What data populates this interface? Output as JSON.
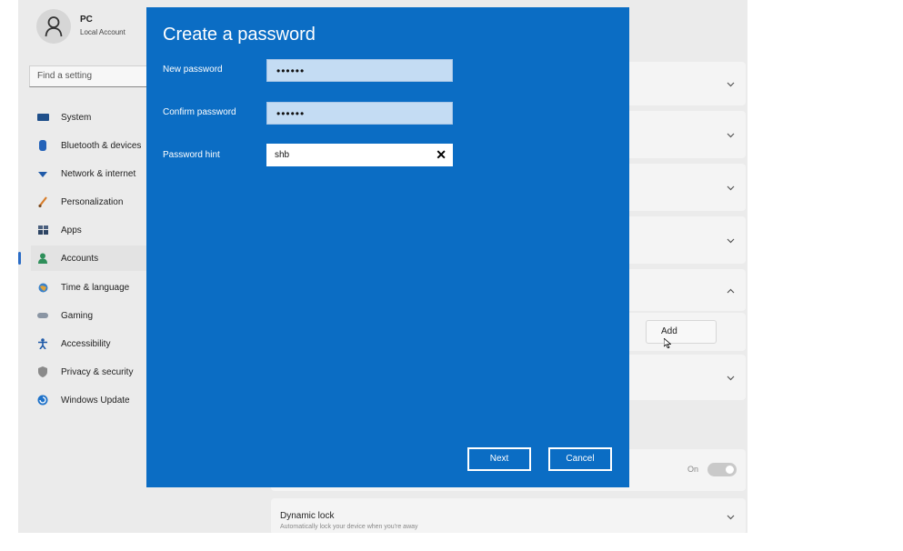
{
  "account": {
    "name": "PC",
    "type": "Local Account"
  },
  "search": {
    "placeholder": "Find a setting"
  },
  "sidebar": {
    "items": [
      {
        "label": "System",
        "icon": "monitor-icon"
      },
      {
        "label": "Bluetooth & devices",
        "icon": "bluetooth-icon"
      },
      {
        "label": "Network & internet",
        "icon": "wifi-icon"
      },
      {
        "label": "Personalization",
        "icon": "brush-icon"
      },
      {
        "label": "Apps",
        "icon": "apps-icon"
      },
      {
        "label": "Accounts",
        "icon": "person-icon",
        "active": true
      },
      {
        "label": "Time & language",
        "icon": "globe-icon"
      },
      {
        "label": "Gaming",
        "icon": "gamepad-icon"
      },
      {
        "label": "Accessibility",
        "icon": "accessibility-icon"
      },
      {
        "label": "Privacy & security",
        "icon": "shield-icon"
      },
      {
        "label": "Windows Update",
        "icon": "update-icon"
      }
    ]
  },
  "background": {
    "add_label": "Add",
    "toggle_label": "On",
    "dynamic_lock": {
      "title": "Dynamic lock",
      "subtitle": "Automatically lock your device when you're away"
    }
  },
  "dialog": {
    "title": "Create a password",
    "new_password": {
      "label": "New password",
      "value": "••••••"
    },
    "confirm_password": {
      "label": "Confirm password",
      "value": "••••••"
    },
    "hint": {
      "label": "Password hint",
      "value": "shb"
    },
    "next_label": "Next",
    "cancel_label": "Cancel"
  },
  "colors": {
    "dialog": "#0b6dc4",
    "accent": "#2a6cc6"
  }
}
